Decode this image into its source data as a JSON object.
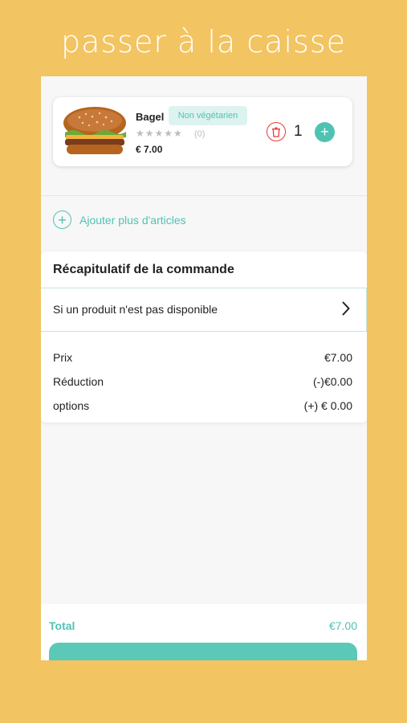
{
  "headline": "passer à la caisse",
  "cart": {
    "item": {
      "name": "Bagel",
      "badge": "Non végétarien",
      "stars": "★★★★★",
      "rating_count": "(0)",
      "price": "€ 7.00",
      "quantity": "1"
    },
    "add_more_label": "Ajouter plus d'articles"
  },
  "summary": {
    "title": "Récapitulatif de la commande",
    "unavailable_label": "Si un produit n'est pas disponible",
    "rows": [
      {
        "label": "Prix",
        "value": "€7.00"
      },
      {
        "label": "Réduction",
        "value": "(-)€0.00"
      },
      {
        "label": "options",
        "value": "(+) € 0.00"
      }
    ]
  },
  "footer": {
    "total_label": "Total",
    "total_value": "€7.00"
  },
  "colors": {
    "accent": "#4FC3B3",
    "background": "#F2C462",
    "danger": "#E53935"
  },
  "icons": [
    "trash-icon",
    "plus-icon",
    "add-circle-icon",
    "chevron-right-icon",
    "food-image"
  ]
}
